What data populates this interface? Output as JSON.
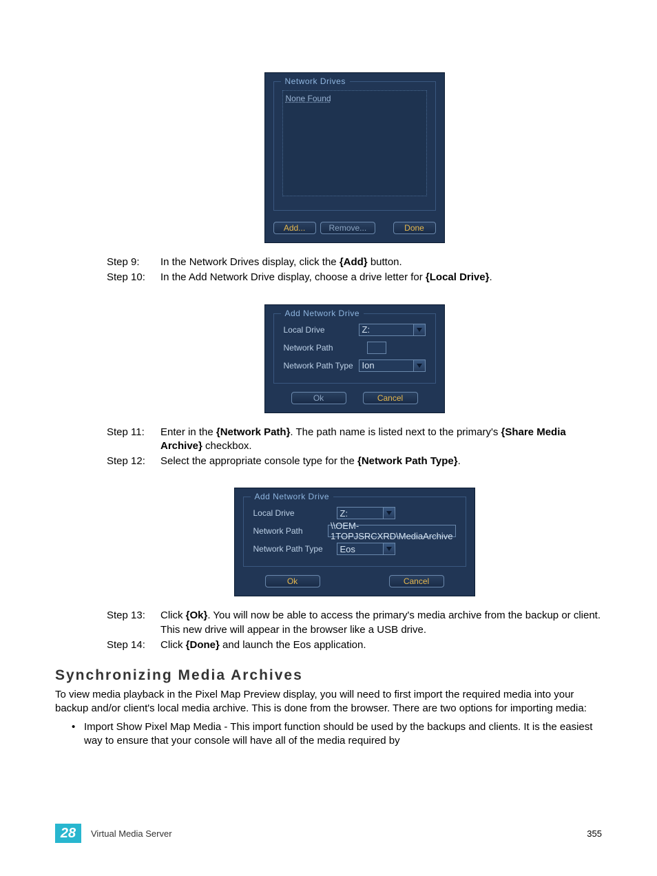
{
  "panels": {
    "network_drives": {
      "legend": "Network Drives",
      "list_item": "None Found",
      "add_btn": "Add...",
      "remove_btn": "Remove...",
      "done_btn": "Done"
    },
    "add_drive_1": {
      "legend": "Add Network Drive",
      "local_drive_label": "Local Drive",
      "local_drive_value": "Z:",
      "network_path_label": "Network Path",
      "network_path_value": "",
      "network_path_type_label": "Network Path Type",
      "network_path_type_value": "Ion",
      "ok_btn": "Ok",
      "cancel_btn": "Cancel"
    },
    "add_drive_2": {
      "legend": "Add Network Drive",
      "local_drive_label": "Local Drive",
      "local_drive_value": "Z:",
      "network_path_label": "Network Path",
      "network_path_value": "\\\\OEM-1TOPJSRCXRD\\MediaArchive",
      "network_path_type_label": "Network Path Type",
      "network_path_type_value": "Eos",
      "ok_btn": "Ok",
      "cancel_btn": "Cancel"
    }
  },
  "steps": {
    "s9": {
      "label": "Step 9:",
      "t1": "In the Network Drives display, click the ",
      "b1": "{Add}",
      "t2": " button."
    },
    "s10": {
      "label": "Step 10:",
      "t1": "In the Add Network Drive display, choose a drive letter for ",
      "b1": "{Local Drive}",
      "t2": "."
    },
    "s11": {
      "label": "Step 11:",
      "t1": "Enter in the ",
      "b1": "{Network Path}",
      "t2": ". The path name is listed next to the primary's ",
      "b2": "{Share Media Archive}",
      "t3": " checkbox."
    },
    "s12": {
      "label": "Step 12:",
      "t1": "Select the appropriate console type for the ",
      "b1": "{Network Path Type}",
      "t2": "."
    },
    "s13": {
      "label": "Step 13:",
      "t1": "Click ",
      "b1": "{Ok}",
      "t2": ". You will now be able to access the primary's media archive from the backup or client. This new drive will appear in the browser like a USB drive."
    },
    "s14": {
      "label": "Step 14:",
      "t1": "Click ",
      "b1": "{Done}",
      "t2": " and launch the Eos application."
    }
  },
  "section": {
    "title": "Synchronizing Media Archives",
    "para": "To view media playback in the Pixel Map Preview display, you will need to first import the required media into your backup and/or client's local media archive. This is done from the browser. There are two options for importing media:",
    "bullet1": "Import Show Pixel Map Media - This import function should be used by the backups and clients. It is the easiest way to ensure that your console will have all of the media required by"
  },
  "footer": {
    "chapter": "28",
    "title": "Virtual Media Server",
    "page": "355"
  }
}
